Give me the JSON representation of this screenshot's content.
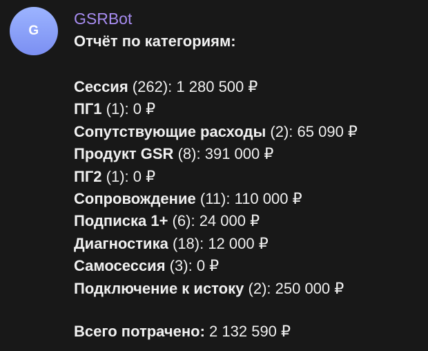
{
  "avatar": {
    "letter": "G",
    "color": "#8ea2f8"
  },
  "sender": {
    "name": "GSRBot",
    "color": "#a78cf0"
  },
  "report": {
    "header": "Отчёт по категориям:",
    "items": [
      {
        "name": "Сессия",
        "count": "262",
        "amount": "1 280 500 ₽"
      },
      {
        "name": "ПГ1",
        "count": "1",
        "amount": "0 ₽"
      },
      {
        "name": "Сопутствующие расходы",
        "count": "2",
        "amount": "65 090 ₽"
      },
      {
        "name": "Продукт GSR",
        "count": "8",
        "amount": "391 000 ₽"
      },
      {
        "name": "ПГ2",
        "count": "1",
        "amount": "0 ₽"
      },
      {
        "name": "Сопровождение",
        "count": "11",
        "amount": "110 000 ₽"
      },
      {
        "name": "Подписка 1+",
        "count": "6",
        "amount": "24 000 ₽"
      },
      {
        "name": "Диагностика",
        "count": "18",
        "amount": "12 000 ₽"
      },
      {
        "name": "Самосессия",
        "count": "3",
        "amount": "0 ₽"
      },
      {
        "name": "Подключение к истоку",
        "count": "2",
        "amount": "250 000 ₽"
      }
    ],
    "total": {
      "label": "Всего потрачено:",
      "amount": "2 132 590 ₽"
    }
  }
}
